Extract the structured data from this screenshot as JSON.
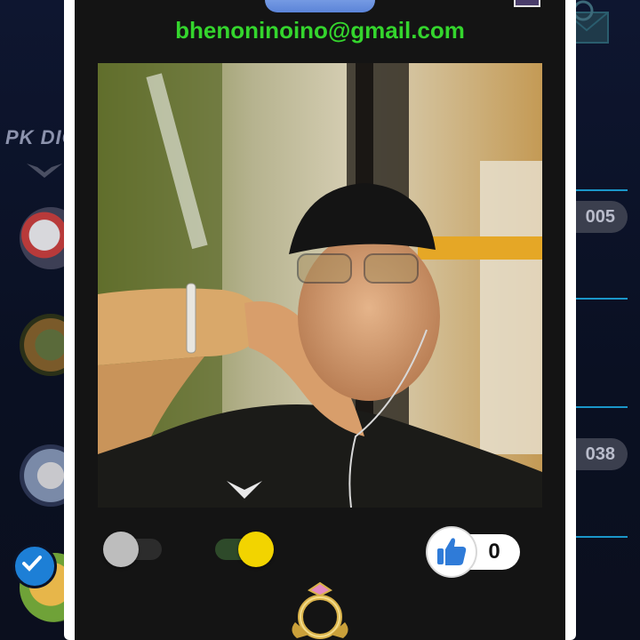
{
  "background_app": {
    "title": "PK DIG",
    "pills": [
      "005",
      "038"
    ],
    "accent_color": "#1a96c9"
  },
  "modal": {
    "email": "bhenoninoino@gmail.com",
    "email_color": "#34d52d",
    "photo": {
      "subject": "selfie-photo"
    },
    "toggles": [
      {
        "name": "toggle-left",
        "state": "off",
        "knob_color": "#bdbdbd"
      },
      {
        "name": "toggle-right",
        "state": "on",
        "knob_color": "#f2d400"
      }
    ],
    "like": {
      "icon": "thumbs-up-icon",
      "count": "0",
      "icon_color": "#2f7bd8"
    },
    "crest": {
      "icon": "ring-crest-icon"
    }
  }
}
